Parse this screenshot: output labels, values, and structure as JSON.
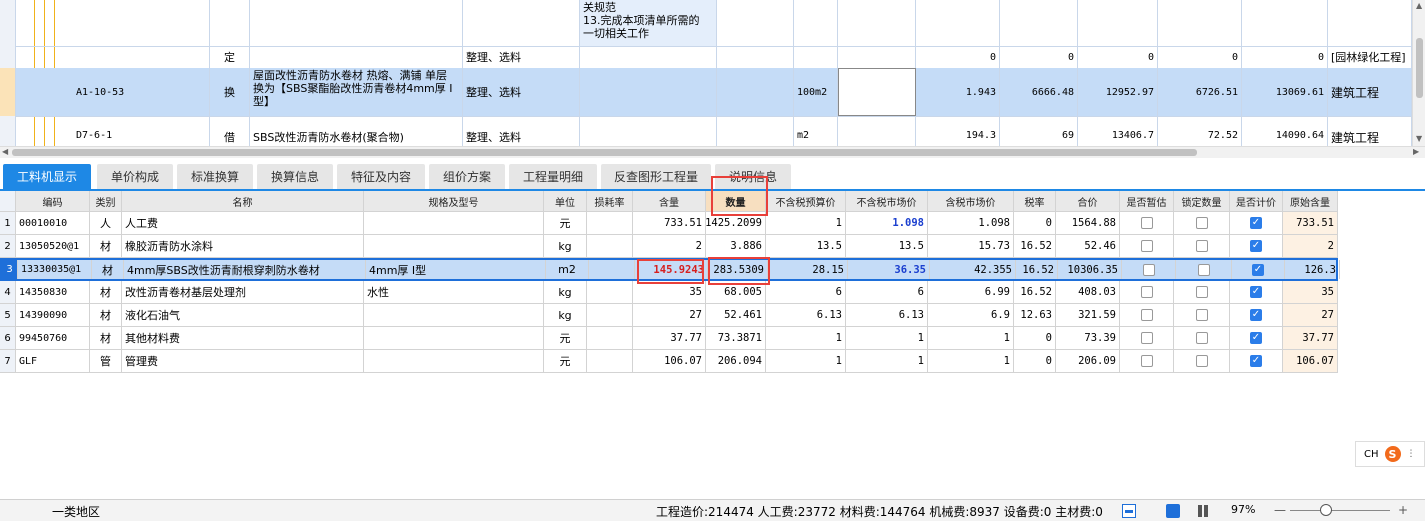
{
  "top_grid": {
    "row_partial": {
      "desc_lines": [
        "关规范",
        "13.完成本项清单所需的",
        "一切相关工作"
      ]
    },
    "row_ding": {
      "type": "定",
      "work": "整理、选料",
      "n1": "0",
      "n2": "0",
      "n3": "0",
      "n4": "0",
      "n5": "0",
      "category": "[园林绿化工程]"
    },
    "row_selected": {
      "code": "A1-10-53",
      "type": "换",
      "name": "屋面改性沥青防水卷材 热熔、满铺 单层  换为【SBS聚酯胎改性沥青卷材4mm厚 I型】",
      "work": "整理、选料",
      "unit": "100m2",
      "n1": "1.943",
      "n2": "6666.48",
      "n3": "12952.97",
      "n4": "6726.51",
      "n5": "13069.61",
      "category": "建筑工程"
    },
    "row_jie": {
      "code": "D7-6-1",
      "type": "借",
      "name": "SBS改性沥青防水卷材(聚合物)",
      "work": "整理、选料",
      "unit": "m2",
      "n1": "194.3",
      "n2": "69",
      "n3": "13406.7",
      "n4": "72.52",
      "n5": "14090.64",
      "category": "建筑工程"
    }
  },
  "tabs": [
    {
      "label": "工料机显示",
      "active": true
    },
    {
      "label": "单价构成"
    },
    {
      "label": "标准换算"
    },
    {
      "label": "换算信息"
    },
    {
      "label": "特征及内容"
    },
    {
      "label": "组价方案"
    },
    {
      "label": "工程量明细"
    },
    {
      "label": "反查图形工程量"
    },
    {
      "label": "说明信息"
    }
  ],
  "grid": {
    "headers": [
      "编码",
      "类别",
      "名称",
      "规格及型号",
      "单位",
      "损耗率",
      "含量",
      "数量",
      "不含税预算价",
      "不含税市场价",
      "含税市场价",
      "税率",
      "合价",
      "是否暂估",
      "锁定数量",
      "是否计价",
      "原始含量"
    ],
    "rows": [
      {
        "no": "1",
        "code": "00010010",
        "type": "人",
        "name": "人工费",
        "spec": "",
        "unit": "元",
        "loss": "",
        "content": "733.51",
        "qty": "1425.2099",
        "p1": "1",
        "p2": "1.098",
        "p3": "1.098",
        "tax": "0",
        "total": "1564.88",
        "est": false,
        "lock": false,
        "priced": true,
        "orig": "733.51"
      },
      {
        "no": "2",
        "code": "13050520@1",
        "type": "材",
        "name": "橡胶沥青防水涂料",
        "spec": "",
        "unit": "kg",
        "loss": "",
        "content": "2",
        "qty": "3.886",
        "p1": "13.5",
        "p2": "13.5",
        "p3": "15.73",
        "tax": "16.52",
        "total": "52.46",
        "est": false,
        "lock": false,
        "priced": true,
        "orig": "2"
      },
      {
        "no": "3",
        "code": "13330035@1",
        "type": "材",
        "name": "4mm厚SBS改性沥青耐根穿刺防水卷材",
        "spec": "4mm厚 I型",
        "unit": "m2",
        "loss": "",
        "content": "145.9243",
        "qty": "283.5309",
        "p1": "28.15",
        "p2": "36.35",
        "p3": "42.355",
        "tax": "16.52",
        "total": "10306.35",
        "est": false,
        "lock": false,
        "priced": true,
        "orig": "126.3"
      },
      {
        "no": "4",
        "code": "14350830",
        "type": "材",
        "name": "改性沥青卷材基层处理剂",
        "spec": "水性",
        "unit": "kg",
        "loss": "",
        "content": "35",
        "qty": "68.005",
        "p1": "6",
        "p2": "6",
        "p3": "6.99",
        "tax": "16.52",
        "total": "408.03",
        "est": false,
        "lock": false,
        "priced": true,
        "orig": "35"
      },
      {
        "no": "5",
        "code": "14390090",
        "type": "材",
        "name": "液化石油气",
        "spec": "",
        "unit": "kg",
        "loss": "",
        "content": "27",
        "qty": "52.461",
        "p1": "6.13",
        "p2": "6.13",
        "p3": "6.9",
        "tax": "12.63",
        "total": "321.59",
        "est": false,
        "lock": false,
        "priced": true,
        "orig": "27"
      },
      {
        "no": "6",
        "code": "99450760",
        "type": "材",
        "name": "其他材料费",
        "spec": "",
        "unit": "元",
        "loss": "",
        "content": "37.77",
        "qty": "73.3871",
        "p1": "1",
        "p2": "1",
        "p3": "1",
        "tax": "0",
        "total": "73.39",
        "est": false,
        "lock": false,
        "priced": true,
        "orig": "37.77"
      },
      {
        "no": "7",
        "code": "GLF",
        "type": "管",
        "name": "管理费",
        "spec": "",
        "unit": "元",
        "loss": "",
        "content": "106.07",
        "qty": "206.094",
        "p1": "1",
        "p2": "1",
        "p3": "1",
        "tax": "0",
        "total": "206.09",
        "est": false,
        "lock": false,
        "priced": true,
        "orig": "106.07"
      }
    ]
  },
  "ime": {
    "label": "CH",
    "logo": "S"
  },
  "status": {
    "region": "一类地区",
    "summary": "工程造价:214474  人工费:23772  材料费:144764  机械费:8937  设备费:0  主材费:0",
    "zoom": "97%"
  },
  "colors": {
    "accent": "#1e88e5",
    "selected_row": "#c5dcf7",
    "highlight_border": "#e8403a",
    "tree_line": "#f0b21a"
  }
}
